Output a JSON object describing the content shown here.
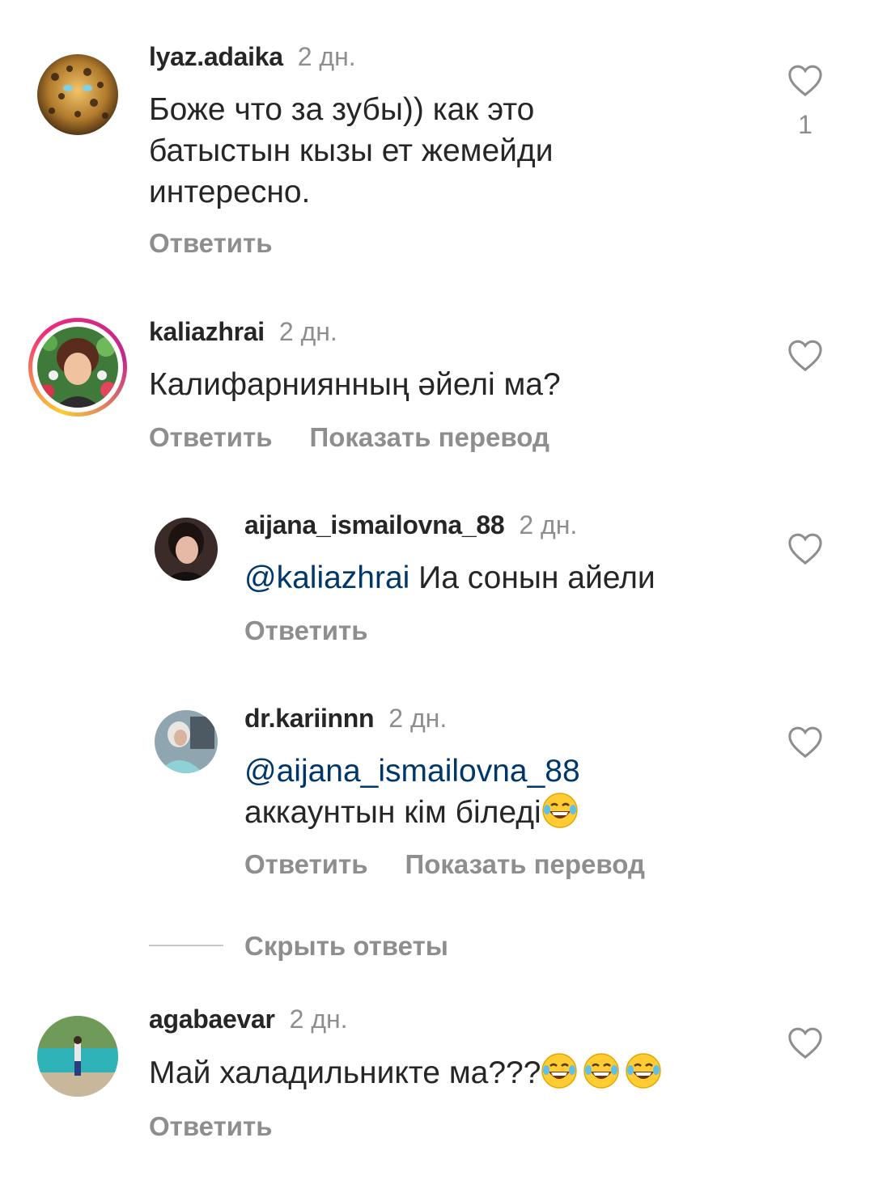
{
  "comments": [
    {
      "username": "lyaz.adaika",
      "time": "2 дн.",
      "text_lines": [
        "Боже что за зубы)) как это",
        "батыстын кызы ет жемейди",
        "интересно."
      ],
      "like_count": "1",
      "reply_label": "Ответить",
      "avatar_icon": "leopard-avatar"
    },
    {
      "username": "kaliazhrai",
      "time": "2 дн.",
      "text": "Калифарниянның әйелі ма?",
      "reply_label": "Ответить",
      "translate_label": "Показать перевод",
      "has_story_ring": true,
      "avatar_icon": "woman-flowers-avatar"
    }
  ],
  "replies": [
    {
      "username": "aijana_ismailovna_88",
      "time": "2 дн.",
      "mention": "@kaliazhrai",
      "text": " Иа сонын айели",
      "reply_label": "Ответить",
      "avatar_icon": "woman-portrait-avatar"
    },
    {
      "username": "dr.kariinnn",
      "time": "2 дн.",
      "mention": "@aijana_ismailovna_88",
      "text": "аккаунтын кім біледі",
      "emoji": "laughing-tears-emoji",
      "reply_label": "Ответить",
      "translate_label": "Показать перевод",
      "avatar_icon": "doctor-avatar"
    }
  ],
  "hide_replies_label": "Скрыть ответы",
  "last_comment": {
    "username": "agabaevar",
    "time": "2 дн.",
    "text": "Май халадильникте ма???",
    "emoji_count": 3,
    "reply_label": "Ответить",
    "avatar_icon": "lake-scenery-avatar"
  },
  "colors": {
    "text": "#262626",
    "secondary": "#8e8e8e",
    "mention": "#00376b",
    "story_ring_start": "#f9ce34",
    "story_ring_mid": "#ee2a7b",
    "story_ring_end": "#6228d7"
  }
}
